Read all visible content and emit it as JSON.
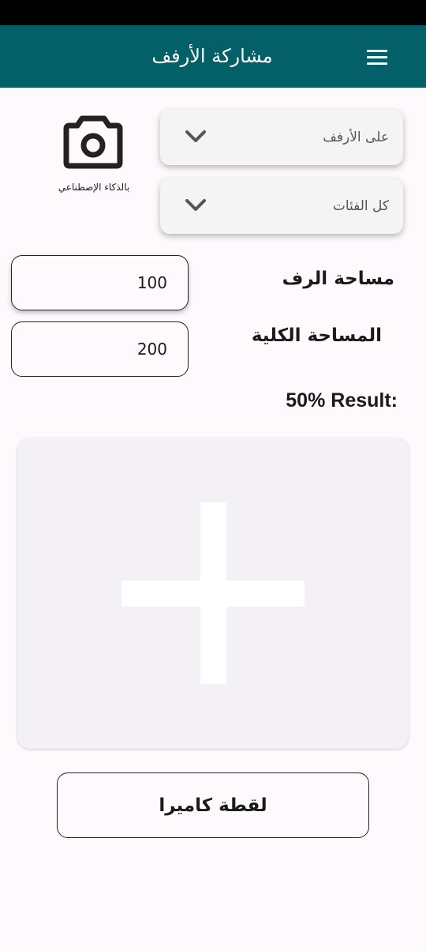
{
  "app_bar": {
    "title": "مشاركة الأرفف",
    "menu_icon": "menu-icon",
    "color": "#035f68"
  },
  "dropdowns": {
    "shelf": {
      "selected": "على الأرفف",
      "icon": "chevron-down-icon"
    },
    "category": {
      "selected": "كل الفئات",
      "icon": "chevron-down-icon"
    }
  },
  "ai_camera": {
    "icon": "camera-icon",
    "label": "بالذكاء الإصطناعي"
  },
  "form": {
    "shelf_area": {
      "label": "مساحة الرف",
      "value": "100"
    },
    "total_area": {
      "label": "المساحة الكلية",
      "value": "200"
    }
  },
  "result": {
    "text": "50% Result:"
  },
  "image_picker": {
    "icon": "plus-icon"
  },
  "camera_button": {
    "label": "لقطة كاميرا"
  }
}
